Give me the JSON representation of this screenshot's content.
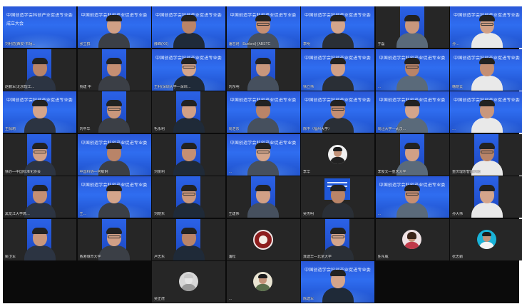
{
  "meeting": {
    "banner_text": "中国创造学会科创产业促进专业委员会",
    "banner_sub": "成立大会"
  },
  "tiles": [
    {
      "row": 0,
      "col": 0,
      "kind": "banner-only",
      "name": "刘利前(西安-市场...",
      "sub": true
    },
    {
      "row": 0,
      "col": 1,
      "kind": "blue-person",
      "name": "张立群"
    },
    {
      "row": 0,
      "col": 2,
      "kind": "blue-person",
      "name": "薛峰(XX)"
    },
    {
      "row": 0,
      "col": 3,
      "kind": "blue-person",
      "name": "潘志刚（Sunlord)-[ABSTC"
    },
    {
      "row": 0,
      "col": 4,
      "kind": "blue-person",
      "name": "李明"
    },
    {
      "row": 0,
      "col": 5,
      "kind": "dark-vbar",
      "name": "于磊"
    },
    {
      "row": 0,
      "col": 6,
      "kind": "blue-person",
      "name": "孙…"
    },
    {
      "row": 1,
      "col": 0,
      "kind": "dark-vbar",
      "name": "赵鹏军(北京理工…"
    },
    {
      "row": 1,
      "col": 1,
      "kind": "dark-vbar",
      "name": "杨建 中"
    },
    {
      "row": 1,
      "col": 2,
      "kind": "blue-person",
      "name": "王利(深圳大学—深圳…"
    },
    {
      "row": 1,
      "col": 3,
      "kind": "dark-vbar",
      "name": "刘东明"
    },
    {
      "row": 1,
      "col": 4,
      "kind": "blue-person",
      "name": "徐立伟"
    },
    {
      "row": 1,
      "col": 5,
      "kind": "blue-person",
      "name": "…"
    },
    {
      "row": 1,
      "col": 6,
      "kind": "blue-person",
      "name": "韩晓云"
    },
    {
      "row": 2,
      "col": 0,
      "kind": "blue-person",
      "name": "王佩莉"
    },
    {
      "row": 2,
      "col": 1,
      "kind": "dark-vbar",
      "name": "刘中华"
    },
    {
      "row": 2,
      "col": 2,
      "kind": "dark-vbar",
      "name": "毛永利"
    },
    {
      "row": 2,
      "col": 3,
      "kind": "blue-person",
      "name": "周浩东"
    },
    {
      "row": 2,
      "col": 4,
      "kind": "blue-person",
      "name": "陈中（福州大学）"
    },
    {
      "row": 2,
      "col": 5,
      "kind": "blue-person",
      "name": "周迅大学—武汉…"
    },
    {
      "row": 2,
      "col": 6,
      "kind": "blue-person",
      "name": "…"
    },
    {
      "row": 3,
      "col": 0,
      "kind": "dark-vbar",
      "name": "徐亦—中国标准化协会"
    },
    {
      "row": 3,
      "col": 1,
      "kind": "blue-person",
      "name": "中国科协—何敏俐"
    },
    {
      "row": 3,
      "col": 2,
      "kind": "dark-vbar",
      "name": "刘俊利"
    },
    {
      "row": 3,
      "col": 3,
      "kind": "blue-person",
      "name": "…"
    },
    {
      "row": 3,
      "col": 4,
      "kind": "avatar",
      "avatar": "white",
      "name": "李华"
    },
    {
      "row": 3,
      "col": 5,
      "kind": "dark-vbar",
      "name": "李俊文—重庆大学"
    },
    {
      "row": 3,
      "col": 6,
      "kind": "dark-vbar",
      "name": "重庆理想智能科技"
    },
    {
      "row": 4,
      "col": 0,
      "kind": "dark-vbar",
      "name": "黑龙江大学高…"
    },
    {
      "row": 4,
      "col": 1,
      "kind": "blue-person",
      "name": "王…"
    },
    {
      "row": 4,
      "col": 2,
      "kind": "dark-vbar",
      "name": "刘晓东"
    },
    {
      "row": 4,
      "col": 3,
      "kind": "dark-vbar",
      "name": "王建伟"
    },
    {
      "row": 4,
      "col": 4,
      "kind": "poster-person",
      "name": "吴杰明"
    },
    {
      "row": 4,
      "col": 5,
      "kind": "blue-person",
      "name": "…"
    },
    {
      "row": 4,
      "col": 6,
      "kind": "dark-vbar",
      "name": "孙大伟"
    },
    {
      "row": 5,
      "col": 0,
      "kind": "dark-vbar",
      "name": "姚卫军"
    },
    {
      "row": 5,
      "col": 1,
      "kind": "dark-vbar",
      "name": "香港城市大学"
    },
    {
      "row": 5,
      "col": 2,
      "kind": "dark-vbar",
      "name": "卢志东"
    },
    {
      "row": 5,
      "col": 3,
      "kind": "seal",
      "name": "浦松"
    },
    {
      "row": 5,
      "col": 4,
      "kind": "dark-vbar",
      "name": "龚建华—北京大学"
    },
    {
      "row": 5,
      "col": 5,
      "kind": "avatar",
      "avatar": "pink",
      "name": "任东威"
    },
    {
      "row": 5,
      "col": 6,
      "kind": "avatar",
      "avatar": "teal",
      "name": "张志勤"
    },
    {
      "row": 6,
      "col": 2,
      "kind": "avatar",
      "avatar": "grey",
      "name": "吴正虎"
    },
    {
      "row": 6,
      "col": 3,
      "kind": "avatar",
      "avatar": "cream",
      "name": "…"
    },
    {
      "row": 6,
      "col": 4,
      "kind": "blue-person",
      "name": "陈建军"
    }
  ],
  "colors": {
    "background": "#0b0b0b",
    "tile_blue": "#2f6df0",
    "tile_dark": "#262626"
  }
}
